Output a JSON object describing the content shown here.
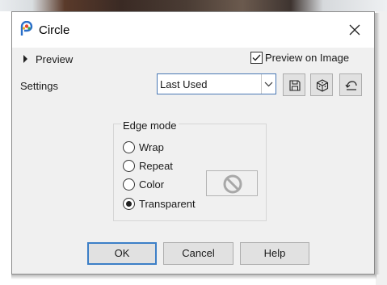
{
  "window": {
    "title": "Circle",
    "icon": "paintshop-pro-icon"
  },
  "preview": {
    "label": "Preview",
    "preview_on_image_label": "Preview on Image",
    "preview_on_image_checked": true
  },
  "settings": {
    "label": "Settings",
    "preset_value": "Last Used",
    "tools": [
      "save-preset-icon",
      "randomize-icon",
      "reset-icon"
    ]
  },
  "edge_mode": {
    "title": "Edge mode",
    "options": [
      {
        "label": "Wrap",
        "selected": false
      },
      {
        "label": "Repeat",
        "selected": false
      },
      {
        "label": "Color",
        "selected": false
      },
      {
        "label": "Transparent",
        "selected": true
      }
    ],
    "color_swatch_icon": "no-color-icon"
  },
  "buttons": {
    "ok": "OK",
    "cancel": "Cancel",
    "help": "Help"
  },
  "colors": {
    "accent": "#3c7fc7",
    "dialog_bg": "#f0f0f0",
    "button_bg": "#e1e1e1"
  }
}
